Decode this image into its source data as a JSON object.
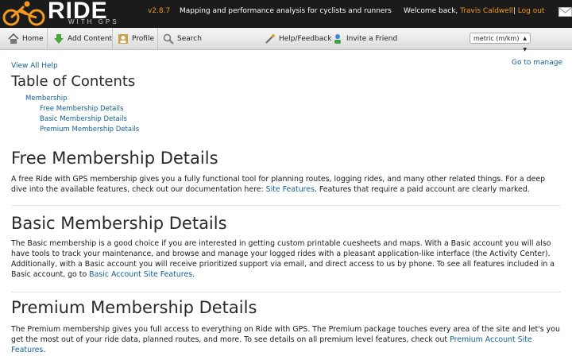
{
  "header": {
    "logo_text": "RIDE",
    "logo_sub": "WITH GPS",
    "version": "v2.8.7",
    "tagline": "Mapping and performance analysis for cyclists and runners",
    "welcome_prefix": "Welcome back,",
    "user_name": "Travis Caldwell",
    "separator": "|",
    "logout": "Log out",
    "accent": "#f39a1e"
  },
  "toolbar": {
    "home": "Home",
    "add_content": "Add Content",
    "profile": "Profile",
    "search": "Search",
    "help": "Help/Feedback",
    "invite": "Invite a Friend",
    "units": "metric (m/km)"
  },
  "help": {
    "view_all": "View All Help",
    "goto_manage": "Go to manage",
    "toc_title": "Table of Contents",
    "toc_items": [
      "Membership",
      "Free Membership Details",
      "Basic Membership Details",
      "Premium Membership Details"
    ]
  },
  "sections": {
    "free": {
      "title": "Free Membership Details",
      "text_before": "A free Ride with GPS membership gives you a fully functional tool for planning routes, logging rides, and many other related things. For a deep dive into the available features, check out our documentation here: ",
      "link": "Site Features",
      "text_after": ". Features that require a paid account are clearly marked."
    },
    "basic": {
      "title": "Basic Membership Details",
      "text_before": "The Basic membership is a good choice if you are interested in getting custom printable cuesheets and maps. With a Basic account you will also have tools to track your maintenance, and browse and manage your logged rides with a pleasant application-like interface (the Activity Center). Additionally, with a Basic account you will receive prioritized support via email, and direct access to us by phone. To see all features included in a Basic account, go to ",
      "link": "Basic Account Site Features",
      "text_after": "."
    },
    "premium": {
      "title": "Premium Membership Details",
      "text_before": "The Premium membership gives you full access to everything on Ride with GPS. The Premium package touches every area of the site and let's you get the most out of your ride data, planned routes, and more. To see details on all premium level features, check out ",
      "link": "Premium Account Site Features",
      "text_after": "."
    }
  },
  "icons": [
    "cyclist-logo-icon",
    "mail-icon",
    "home-icon",
    "add-content-icon",
    "profile-icon",
    "search-icon",
    "help-icon",
    "invite-icon",
    "chevron-down-icon"
  ]
}
